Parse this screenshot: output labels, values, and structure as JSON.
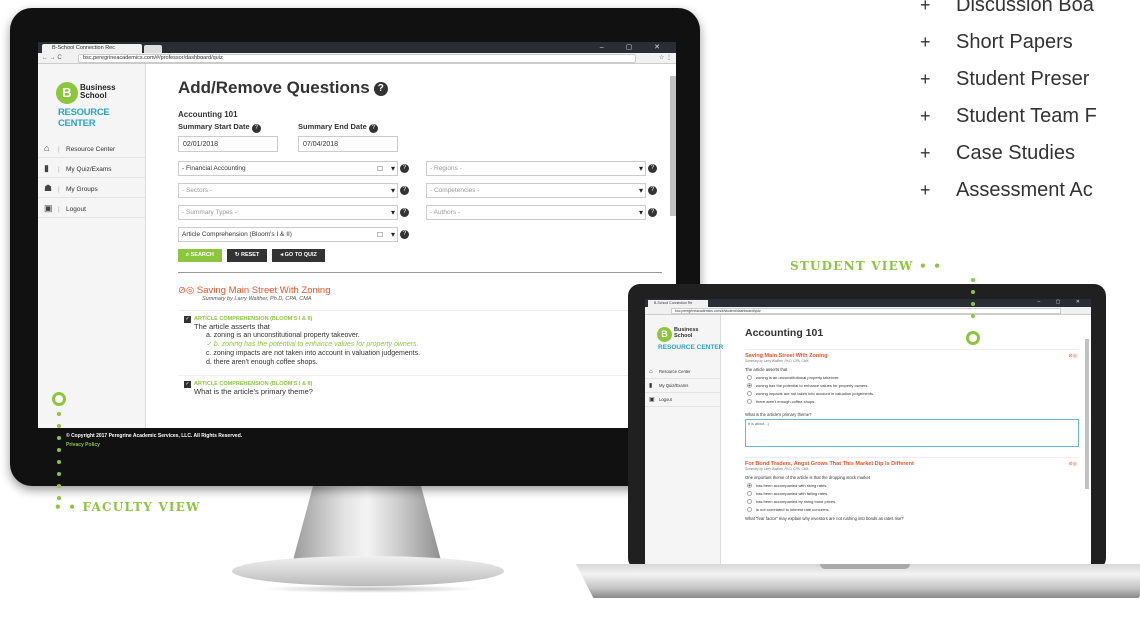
{
  "features": [
    "Discussion Boa",
    "Short Papers",
    "Student Preser",
    "Student Team F",
    "Case Studies",
    "Assessment Ac"
  ],
  "feature_bullet": "+",
  "labels": {
    "faculty": "FACULTY VIEW",
    "student": "STUDENT VIEW"
  },
  "faculty": {
    "tab_title": "B-School Connection Rec",
    "url": "bsc.peregrineacademics.com/#/professor/dashboard/quiz",
    "logo": {
      "line1": "Business",
      "line2": "School",
      "line3": "RESOURCE CENTER",
      "mark": "B"
    },
    "nav": [
      {
        "icon": "home-icon",
        "glyph": "⌂",
        "label": "Resource Center"
      },
      {
        "icon": "file-icon",
        "glyph": "▮",
        "label": "My Quiz/Exams"
      },
      {
        "icon": "users-icon",
        "glyph": "☗",
        "label": "My Groups"
      },
      {
        "icon": "lock-icon",
        "glyph": "▣",
        "label": "Logout"
      }
    ],
    "page_title": "Add/Remove Questions",
    "course": "Accounting 101",
    "start_label": "Summary Start Date",
    "start_value": "02/01/2018",
    "end_label": "Summary End Date",
    "end_value": "07/04/2018",
    "filters": [
      "- Financial Accounting",
      "- Regions -",
      "- Sectors -",
      "- Competencies -",
      "- Summary Types -",
      "- Authors -",
      "Article Comprehension (Bloom's I & II)"
    ],
    "buttons": {
      "search": "SEARCH",
      "reset": "RESET",
      "goto": "GO TO QUIZ"
    },
    "article_title": "Saving Main Street With Zoning",
    "article_author": "Summary by Larry Walther, Ph.D, CPA, CMA",
    "q1_tag": "ARTICLE COMPREHENSION (BLOOM'S I & II)",
    "q1_text": "The article asserts that",
    "q1_answers": [
      "a. zoning is an unconstitutional property takeover.",
      "b. zoning has the potential to enhance values for property owners.",
      "c. zoning impacts are not taken into account in valuation judgements.",
      "d. there aren't enough coffee shops."
    ],
    "q2_tag": "ARTICLE COMPREHENSION (BLOOM'S I & II)",
    "q2_text": "What is the article's primary theme?",
    "footer_copy": "© Copyright 2017 Peregrine Academic Services, LLC. All Rights Reserved.",
    "footer_link": "Privacy Policy",
    "social": "f  ✓"
  },
  "student": {
    "tab_title": "B-School Connection Re",
    "url": "bsc.peregrineacademics.com/#/student/dashboard/quiz",
    "logo": {
      "line1": "Business",
      "line2": "School",
      "line3": "RESOURCE CENTER",
      "mark": "B"
    },
    "nav": [
      {
        "icon": "home-icon",
        "glyph": "⌂",
        "label": "Resource Center"
      },
      {
        "icon": "file-icon",
        "glyph": "▮",
        "label": "My Quiz/Exams"
      },
      {
        "icon": "lock-icon",
        "glyph": "▣",
        "label": "Logout"
      }
    ],
    "course": "Accounting 101",
    "a1_title": "Saving Main Street With Zoning",
    "a1_author": "Summary by Larry Walther, Ph.D, CPA, CMA",
    "a1_question": "The article asserts that",
    "a1_options": [
      "zoning is an unconstitutional property takeover.",
      "zoning has the potential to enhance values for property owners.",
      "zoning impacts are not taken into account in valuation judgements.",
      "there aren't enough coffee shops."
    ],
    "a1_selected": 1,
    "a1_text_q": "What is the article's primary theme?",
    "a1_text_a": "It is about...|",
    "a2_title": "For Bond Traders, Angst Grows That This Market Dip Is Different",
    "a2_author": "Summary by Larry Walther, Ph.D, CPA, CMA",
    "a2_question": "One important theme of the article is that the dropping stock market",
    "a2_options": [
      "has been accompanied with rising rates.",
      "has been accompanied with falling rates.",
      "has been accompanied by rising bond prices.",
      "is not correlated to interest rate concerns."
    ],
    "a2_selected": 0,
    "a2_next": "What \"fear factor\" may explain why investors are not rushing into bonds as rates rise?"
  }
}
